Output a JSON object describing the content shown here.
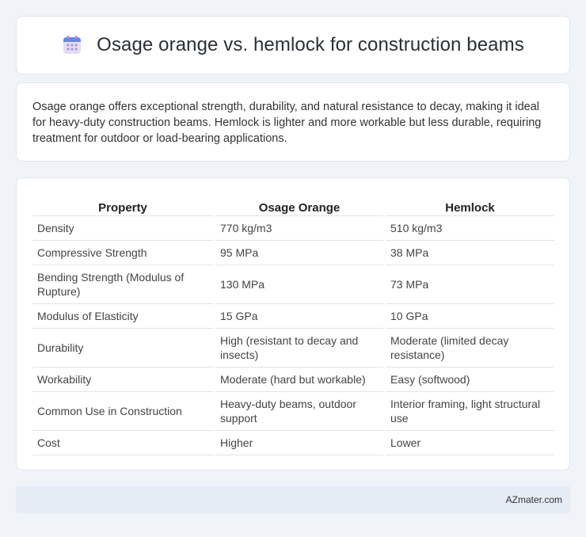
{
  "header": {
    "title": "Osage orange vs. hemlock for construction beams",
    "icon": "calendar-icon"
  },
  "intro": {
    "text": "Osage orange offers exceptional strength, durability, and natural resistance to decay, making it ideal for heavy-duty construction beams. Hemlock is lighter and more workable but less durable, requiring treatment for outdoor or load-bearing applications."
  },
  "table": {
    "headers": [
      "Property",
      "Osage Orange",
      "Hemlock"
    ],
    "rows": [
      [
        "Density",
        "770 kg/m3",
        "510 kg/m3"
      ],
      [
        "Compressive Strength",
        "95 MPa",
        "38 MPa"
      ],
      [
        "Bending Strength (Modulus of Rupture)",
        "130 MPa",
        "73 MPa"
      ],
      [
        "Modulus of Elasticity",
        "15 GPa",
        "10 GPa"
      ],
      [
        "Durability",
        "High (resistant to decay and insects)",
        "Moderate (limited decay resistance)"
      ],
      [
        "Workability",
        "Moderate (hard but workable)",
        "Easy (softwood)"
      ],
      [
        "Common Use in Construction",
        "Heavy-duty beams, outdoor support",
        "Interior framing, light structural use"
      ],
      [
        "Cost",
        "Higher",
        "Lower"
      ]
    ]
  },
  "footer": {
    "brand": "AZmater.com"
  }
}
